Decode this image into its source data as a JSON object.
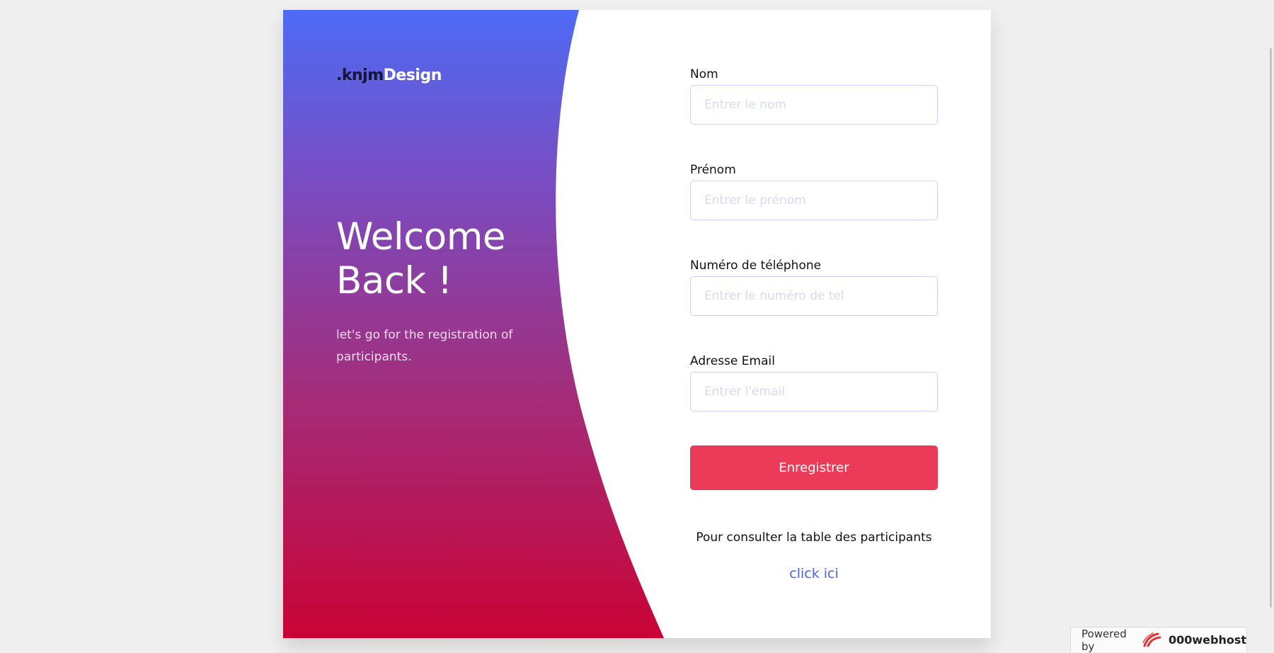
{
  "brand": {
    "logo_dark": ".knjm",
    "logo_light": "Design"
  },
  "hero": {
    "title": "Welcome Back !",
    "subtitle": "let's go for the registration of participants."
  },
  "form": {
    "fields": [
      {
        "label": "Nom",
        "placeholder": "Entrer le nom",
        "value": ""
      },
      {
        "label": "Prénom",
        "placeholder": "Entrer le prénom",
        "value": ""
      },
      {
        "label": "Numéro de téléphone",
        "placeholder": "Entrer le numéro de tel",
        "value": ""
      },
      {
        "label": "Adresse Email",
        "placeholder": "Entrer l'email",
        "value": ""
      }
    ],
    "submit_label": "Enregistrer",
    "consult_text": "Pour consulter la table des participants",
    "consult_link": "click ici"
  },
  "footer_badge": {
    "prefix": "Powered by",
    "brand": "000webhost",
    "icon": "000webhost-logo-icon"
  },
  "colors": {
    "gradient_top": "#4e6bf5",
    "gradient_bottom": "#c90336",
    "submit_button": "#ec3b59",
    "link": "#4b63e6",
    "logo_dark": "#141633"
  }
}
